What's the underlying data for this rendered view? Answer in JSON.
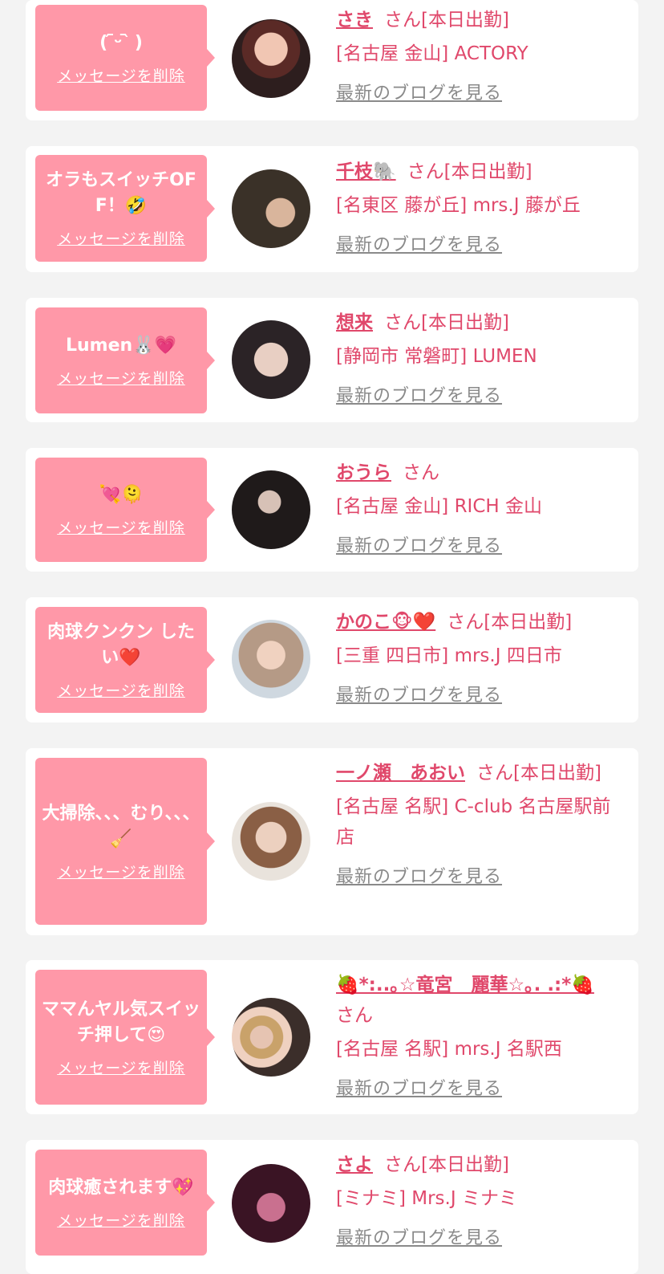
{
  "delete_label": "メッセージを削除",
  "blog_label": "最新のブログを見る",
  "san": "さん",
  "colors": {
    "accent": "#e0486b",
    "bubble": "#ff98a8",
    "background": "#f3f3f3"
  },
  "items": [
    {
      "message": "( ᷇ᵕ ᷆ )",
      "name": "さき",
      "status": "[本日出勤]",
      "shop": "[名古屋 金山] ACTORY"
    },
    {
      "message": "オラもスイッチOFF！🤣",
      "name": "千枝🐘",
      "status": "[本日出勤]",
      "shop": "[名東区 藤が丘] mrs.J 藤が丘"
    },
    {
      "message": "Lumen🐰💗",
      "name": "想来",
      "status": "[本日出勤]",
      "shop": "[静岡市 常磐町] LUMEN"
    },
    {
      "message": "💘🫠",
      "name": "おうら",
      "status": "",
      "shop": "[名古屋 金山] RICH 金山"
    },
    {
      "message": "肉球クンクン したい❤️",
      "name": "かのこ🐵❤️",
      "status": "[本日出勤]",
      "shop": "[三重 四日市] mrs.J 四日市"
    },
    {
      "message": "大掃除、、、むり、、、🧹",
      "name": "一ノ瀬　あおい",
      "status": "[本日出勤]",
      "shop": "[名古屋 名駅] C-club 名古屋駅前店"
    },
    {
      "message": "ママんヤル気スイッチ押して😍",
      "name": "🍓*:..｡☆竜宮　麗華☆｡. .:*🍓",
      "status": "",
      "shop": "[名古屋 名駅] mrs.J 名駅西"
    },
    {
      "message": "肉球癒されます💖",
      "name": "さよ",
      "status": "[本日出勤]",
      "shop": "[ミナミ] Mrs.J ミナミ"
    }
  ]
}
